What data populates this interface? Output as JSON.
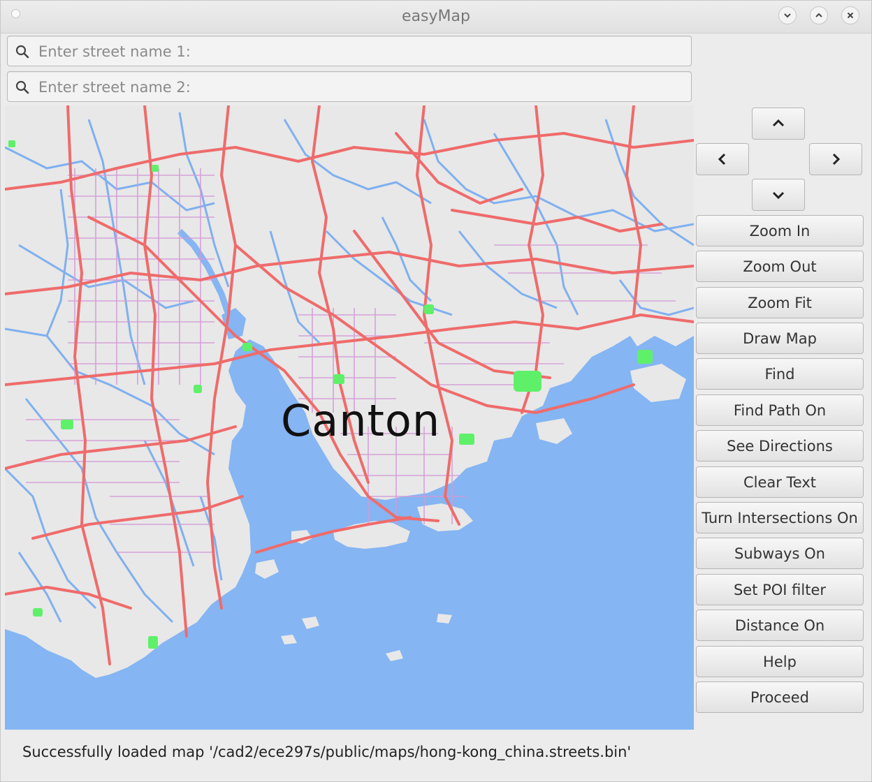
{
  "window": {
    "title": "easyMap"
  },
  "search": {
    "street1_placeholder": "Enter street name 1:",
    "street1_value": "",
    "street2_placeholder": "Enter street name 2:",
    "street2_value": ""
  },
  "map": {
    "label": "Canton",
    "colors": {
      "water": "#85b5f2",
      "land": "#e8e8e8",
      "highway": "#ef6b6b",
      "street": "#d49ad8",
      "river": "#7aaef0",
      "park": "#5ff06a"
    }
  },
  "nav": {
    "up_icon": "chevron-up-icon",
    "down_icon": "chevron-down-icon",
    "left_icon": "chevron-left-icon",
    "right_icon": "chevron-right-icon"
  },
  "buttons": [
    {
      "label": "Zoom In"
    },
    {
      "label": "Zoom Out"
    },
    {
      "label": "Zoom Fit"
    },
    {
      "label": "Draw Map"
    },
    {
      "label": "Find"
    },
    {
      "label": "Find Path On"
    },
    {
      "label": "See Directions"
    },
    {
      "label": "Clear Text"
    },
    {
      "label": "Turn Intersections On"
    },
    {
      "label": "Subways On"
    },
    {
      "label": "Set POI filter"
    },
    {
      "label": "Distance On"
    },
    {
      "label": "Help"
    },
    {
      "label": "Proceed"
    }
  ],
  "status": {
    "message": "Successfully loaded map '/cad2/ece297s/public/maps/hong-kong_china.streets.bin'"
  }
}
